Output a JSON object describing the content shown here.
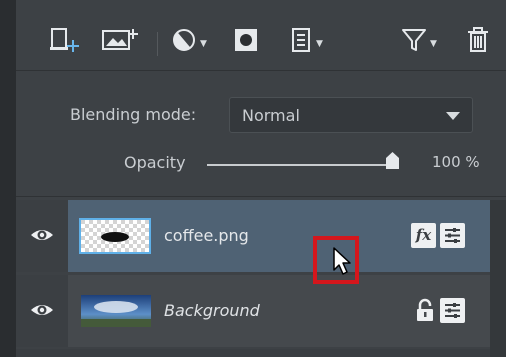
{
  "toolbar": {
    "buttons": [
      {
        "icon": "new-layer-icon"
      },
      {
        "icon": "add-image-layer-icon"
      },
      {
        "icon": "adjustment-layer-icon"
      },
      {
        "icon": "mask-icon"
      },
      {
        "icon": "layer-menu-icon"
      },
      {
        "icon": "filter-icon"
      },
      {
        "icon": "trash-icon"
      }
    ]
  },
  "blending": {
    "label": "Blending mode:",
    "value": "Normal"
  },
  "opacity": {
    "label": "Opacity",
    "value_text": "100 %",
    "value": 1.0
  },
  "layers": [
    {
      "name": "coffee.png",
      "visible": true,
      "selected": true,
      "badges": [
        "fx",
        "properties"
      ]
    },
    {
      "name": "Background",
      "visible": true,
      "selected": false,
      "badges": [
        "lock",
        "properties"
      ]
    }
  ],
  "fx_label": "fx",
  "colors": {
    "accent": "#5fb0e8",
    "selected_row": "#4f6274",
    "highlight": "#d4161c"
  }
}
